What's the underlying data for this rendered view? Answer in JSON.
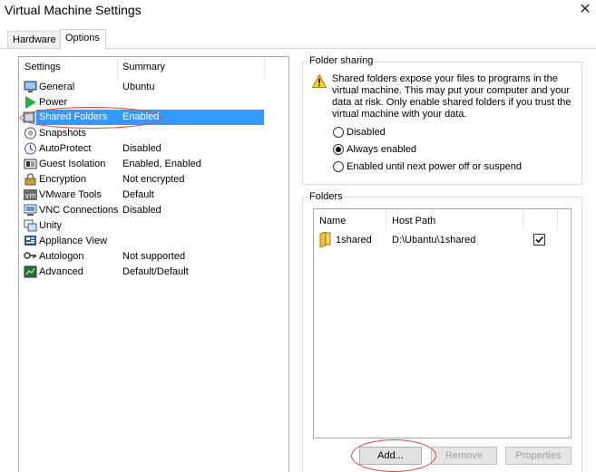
{
  "window": {
    "title": "Virtual Machine Settings",
    "close_glyph": "✕"
  },
  "tabs": [
    {
      "label": "Hardware",
      "active": false
    },
    {
      "label": "Options",
      "active": true
    }
  ],
  "settings_list": {
    "header_settings": "Settings",
    "header_summary": "Summary",
    "items": [
      {
        "label": "General",
        "summary": "Ubuntu",
        "icon": "monitor-icon"
      },
      {
        "label": "Power",
        "summary": "",
        "icon": "play-icon"
      },
      {
        "label": "Shared Folders",
        "summary": "Enabled",
        "icon": "shared-folder-icon",
        "selected": true
      },
      {
        "label": "Snapshots",
        "summary": "",
        "icon": "snapshot-icon"
      },
      {
        "label": "AutoProtect",
        "summary": "Disabled",
        "icon": "autoprotect-icon"
      },
      {
        "label": "Guest Isolation",
        "summary": "Enabled, Enabled",
        "icon": "isolation-icon"
      },
      {
        "label": "Encryption",
        "summary": "Not encrypted",
        "icon": "lock-icon"
      },
      {
        "label": "VMware Tools",
        "summary": "Default",
        "icon": "vm-icon"
      },
      {
        "label": "VNC Connections",
        "summary": "Disabled",
        "icon": "vnc-icon"
      },
      {
        "label": "Unity",
        "summary": "",
        "icon": "unity-icon"
      },
      {
        "label": "Appliance View",
        "summary": "",
        "icon": "appliance-icon"
      },
      {
        "label": "Autologon",
        "summary": "Not supported",
        "icon": "key-icon"
      },
      {
        "label": "Advanced",
        "summary": "Default/Default",
        "icon": "advanced-icon"
      }
    ]
  },
  "folder_sharing": {
    "title": "Folder sharing",
    "warning": "Shared folders expose your files to programs in the virtual machine. This may put your computer and your data at risk. Only enable shared folders if you trust the virtual machine with your data.",
    "options": [
      {
        "label": "Disabled",
        "selected": false
      },
      {
        "label": "Always enabled",
        "selected": true
      },
      {
        "label": "Enabled until next power off or suspend",
        "selected": false
      }
    ]
  },
  "folders": {
    "title": "Folders",
    "col_name": "Name",
    "col_host_path": "Host Path",
    "rows": [
      {
        "name": "1shared",
        "host_path": "D:\\Ubantu\\1shared",
        "checked": true
      }
    ],
    "buttons": {
      "add": "Add...",
      "remove": "Remove",
      "properties": "Properties"
    }
  },
  "colors": {
    "selection": "#3399ff",
    "highlight_ellipse": "#e04040"
  }
}
